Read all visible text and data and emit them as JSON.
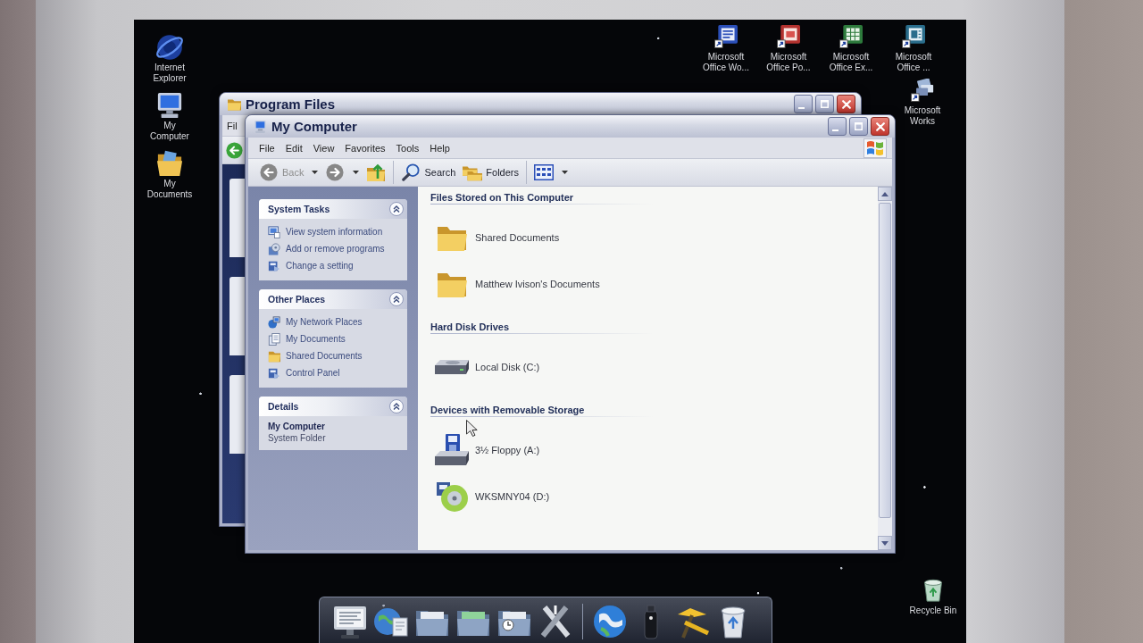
{
  "desktop": {
    "left_icons": [
      {
        "label": "Internet Explorer",
        "kind": "browser"
      },
      {
        "label": "My Computer",
        "kind": "computer"
      },
      {
        "label": "My Documents",
        "kind": "documents"
      }
    ],
    "top_icons": [
      {
        "label": "Microsoft Office Wo...",
        "kind": "word"
      },
      {
        "label": "Microsoft Office Po...",
        "kind": "powerpoint"
      },
      {
        "label": "Microsoft Office Ex...",
        "kind": "excel"
      },
      {
        "label": "Microsoft Office ...",
        "kind": "publisher"
      }
    ],
    "right_icons": [
      {
        "label": "Microsoft Works",
        "kind": "works"
      }
    ],
    "corner_icons": [
      {
        "label": "Recycle Bin",
        "kind": "recycle"
      }
    ]
  },
  "back_window": {
    "title": "Program Files",
    "menu": [
      "Fil"
    ],
    "toolbar": [
      {
        "kind": "back",
        "disabled": false
      }
    ]
  },
  "window": {
    "title": "My Computer",
    "menu": [
      "File",
      "Edit",
      "View",
      "Favorites",
      "Tools",
      "Help"
    ],
    "toolbar": [
      {
        "buttons": [
          {
            "kind": "back",
            "label": "Back",
            "disabled": true,
            "dropdown": true
          },
          {
            "kind": "forward",
            "disabled": true,
            "dropdown": true
          },
          {
            "kind": "up",
            "disabled": false,
            "dropdown": false
          }
        ]
      },
      {
        "buttons": [
          {
            "kind": "search",
            "label": "Search",
            "disabled": false,
            "dropdown": false
          },
          {
            "kind": "folders",
            "label": "Folders",
            "disabled": false,
            "dropdown": false
          }
        ]
      },
      {
        "buttons": [
          {
            "kind": "views",
            "disabled": false,
            "dropdown": true
          }
        ]
      }
    ],
    "task_pane": [
      {
        "kind": "links",
        "title": "System Tasks",
        "expanded": true,
        "links": [
          {
            "label": "View system information",
            "kind": "info"
          },
          {
            "label": "Add or remove programs",
            "kind": "programs"
          },
          {
            "label": "Change a setting",
            "kind": "setting"
          }
        ]
      },
      {
        "kind": "links",
        "title": "Other Places",
        "expanded": true,
        "links": [
          {
            "label": "My Network Places",
            "kind": "network"
          },
          {
            "label": "My Documents",
            "kind": "documents"
          },
          {
            "label": "Shared Documents",
            "kind": "folder"
          },
          {
            "label": "Control Panel",
            "kind": "control"
          }
        ]
      },
      {
        "kind": "details",
        "title": "Details",
        "expanded": true,
        "name": "My Computer",
        "description": "System Folder"
      }
    ],
    "groups": [
      {
        "title": "Files Stored on This Computer",
        "items": [
          {
            "label": "Shared Documents",
            "kind": "folder"
          },
          {
            "label": "Matthew Ivison's Documents",
            "kind": "folder"
          }
        ]
      },
      {
        "title": "Hard Disk Drives",
        "items": [
          {
            "label": "Local Disk (C:)",
            "kind": "harddisk"
          }
        ]
      },
      {
        "title": "Devices with Removable Storage",
        "items": [
          {
            "label": "3½ Floppy (A:)",
            "kind": "floppy"
          },
          {
            "label": "WKSMNY04 (D:)",
            "kind": "cd"
          }
        ]
      }
    ]
  },
  "dock": {
    "sections": [
      {
        "items": [
          {
            "kind": "monitor"
          },
          {
            "kind": "web-document"
          },
          {
            "kind": "folder"
          },
          {
            "kind": "photo-folder"
          },
          {
            "kind": "clock-folder"
          },
          {
            "kind": "tools"
          }
        ]
      },
      {
        "items": [
          {
            "kind": "globe"
          },
          {
            "kind": "bottle"
          },
          {
            "kind": "hammer"
          },
          {
            "kind": "trash"
          }
        ]
      }
    ]
  }
}
